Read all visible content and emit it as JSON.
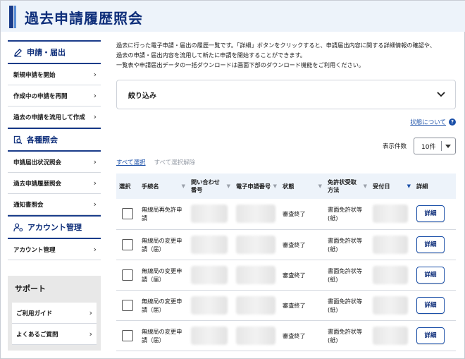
{
  "page": {
    "title": "過去申請履歴照会"
  },
  "sidebar": {
    "sections": [
      {
        "heading": "申請・届出",
        "icon": "pencil-icon",
        "items": [
          "新規申請を開始",
          "作成中の申請を再開",
          "過去の申請を流用して作成"
        ]
      },
      {
        "heading": "各種照会",
        "icon": "search-doc-icon",
        "items": [
          "申請届出状況照会",
          "過去申請履歴照会",
          "通知書照会"
        ]
      },
      {
        "heading": "アカウント管理",
        "icon": "user-gear-icon",
        "items": [
          "アカウント管理"
        ]
      }
    ],
    "support": {
      "title": "サポート",
      "items": [
        "ご利用ガイド",
        "よくあるご質問"
      ]
    }
  },
  "main": {
    "description": [
      "過去に行った電子申請・届出の履歴一覧です。「詳細」ボタンをクリックすると、申請届出内容に関する詳細情報の確認や、",
      "過去の申請・届出内容を流用して新たに申請を開始することができます。",
      "一覧表や申請届出データの一括ダウンロードは画面下部のダウンロード機能をご利用ください。"
    ],
    "filter_label": "絞り込み",
    "status_link": "状態について",
    "count_label": "表示件数",
    "count_value": "10件",
    "select_all": "すべて選択",
    "unselect_all": "すべて選択解除",
    "table": {
      "headers": [
        "選択",
        "手続名",
        "問い合わせ番号",
        "電子申請番号",
        "状態",
        "免許状受取方法",
        "受付日",
        "詳細"
      ],
      "rows": [
        {
          "procedure": "無線局再免許申請",
          "status": "審査終了",
          "receipt": "書面免許状等(紙)",
          "button": "詳細"
        },
        {
          "procedure": "無線局の変更申請（届）",
          "status": "審査終了",
          "receipt": "書面免許状等(紙)",
          "button": "詳細"
        },
        {
          "procedure": "無線局の変更申請（届）",
          "status": "審査終了",
          "receipt": "書面免許状等(紙)",
          "button": "詳細"
        },
        {
          "procedure": "無線局の変更申請（届）",
          "status": "審査終了",
          "receipt": "書面免許状等(紙)",
          "button": "詳細"
        },
        {
          "procedure": "無線局の変更申請（届）",
          "status": "審査終了",
          "receipt": "書面免許状等(紙)",
          "button": "詳細"
        }
      ]
    }
  },
  "colors": {
    "accent": "#0e2e7a",
    "header_bg": "#edf3fa",
    "link": "#1a4fa8"
  }
}
